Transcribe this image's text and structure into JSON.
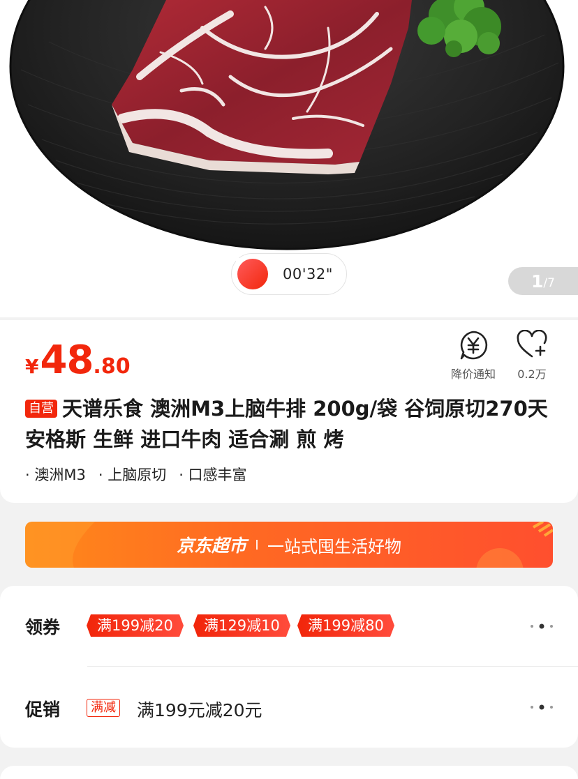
{
  "gallery": {
    "video_duration": "00'32\"",
    "page_current": "1",
    "page_total": "/7"
  },
  "product": {
    "price_symbol": "¥",
    "price_integer": "48",
    "price_decimal": ".80",
    "self_operated_tag": "自营",
    "title": "天谱乐食   澳洲M3上脑牛排 200g/袋  谷饲原切270天安格斯 生鲜 进口牛肉  适合涮 煎 烤",
    "tags": [
      "· 澳洲M3",
      "· 上脑原切",
      "· 口感丰富"
    ]
  },
  "actions": {
    "notify_label": "降价通知",
    "favorite_label": "0.2万"
  },
  "banner": {
    "brand": "京东超市",
    "slogan": "一站式囤生活好物"
  },
  "coupons": {
    "label": "领券",
    "items": [
      "满199减20",
      "满129减10",
      "满199减80"
    ]
  },
  "promotion": {
    "label": "促销",
    "tag": "满减",
    "text": "满199元减20元"
  },
  "colors": {
    "accent_red": "#f2270c",
    "banner_orange": "#ff6a22"
  }
}
